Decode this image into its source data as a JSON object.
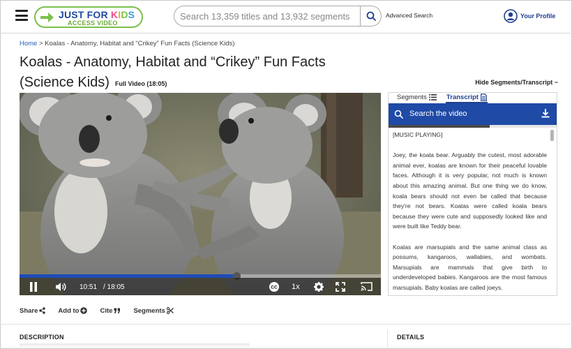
{
  "header": {
    "logo": {
      "line1": [
        "JUST FOR ",
        "K",
        "I",
        "D",
        "S"
      ],
      "line2": "ACCESS VIDEO"
    },
    "search": {
      "placeholder": "Search 13,359 titles and 13,932 segments"
    },
    "advanced_search": "Advanced Search",
    "profile_label": "Your Profile"
  },
  "breadcrumb": {
    "home": "Home",
    "separator": " > ",
    "current": "Koalas - Anatomy, Habitat and “Crikey” Fun Facts (Science Kids)"
  },
  "title": "Koalas - Anatomy, Habitat and “Crikey” Fun Facts (Science Kids)",
  "full_video_label": "Full Video (18:05)",
  "hide_segments_label": "Hide Segments/Transcript −",
  "player": {
    "current_time": "10:51",
    "total_time": "/ 18:05",
    "progress": 0.6,
    "speed": "1x",
    "state": "playing"
  },
  "panel": {
    "tabs": {
      "segments": "Segments",
      "transcript": "Transcript"
    },
    "active_tab": "transcript",
    "search_placeholder": "Search the video",
    "transcript_progress": 0.6,
    "transcript": [
      "[MUSIC PLAYING]",
      "Joey, the koala bear. Arguably the cutest, most adorable animal ever, koalas are known for their peaceful lovable faces. Although it is very popular, not much is known about this amazing animal. But one thing we do know, koala bears should not even be called that because they're not bears. Koalas were called koala bears because they were cute and supposedly looked like and were built like Teddy bear.",
      "Koalas are marsupials and the same animal class as possums, kangaroos, wallabies, and wombats. Marsupials are mammals that give birth to underdeveloped babies. Kangaroos are the most famous marsupials. Baby koalas are called joeys."
    ]
  },
  "actions": {
    "share": "Share",
    "add_to": "Add to",
    "cite": "Cite",
    "segments": "Segments"
  },
  "sections": {
    "description": "DESCRIPTION",
    "details": "DETAILS"
  },
  "colors": {
    "brand_blue": "#1f4aa6",
    "logo_green": "#7cc04b",
    "link_blue": "#1f5fb7"
  }
}
